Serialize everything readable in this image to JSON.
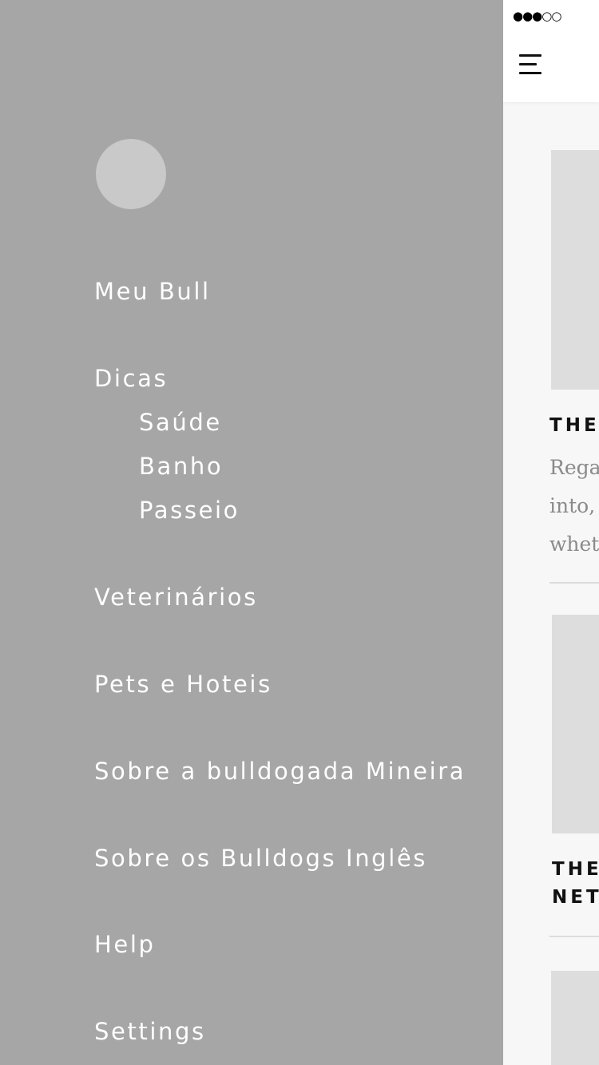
{
  "status_bar": {
    "signal": "●●●○○"
  },
  "drawer": {
    "menu": [
      {
        "label": "Meu Bull"
      },
      {
        "label": "Dicas"
      },
      {
        "label": "Saúde"
      },
      {
        "label": "Banho"
      },
      {
        "label": "Passeio"
      },
      {
        "label": "Veterinários"
      },
      {
        "label": "Pets e Hoteis"
      },
      {
        "label": "Sobre a bulldogada Mineira"
      },
      {
        "label": "Sobre os Bulldogs Inglês"
      },
      {
        "label": "Help"
      },
      {
        "label": "Settings"
      }
    ]
  },
  "main": {
    "cards": [
      {
        "title_lines": [
          "THE"
        ],
        "text_lines": [
          "Rega",
          "into,",
          "whet"
        ]
      },
      {
        "title_lines": [
          "THE",
          "NET"
        ]
      }
    ]
  },
  "colors": {
    "drawer_bg": "#a6a6a6",
    "avatar": "#c9c9c9",
    "content_bg": "#f7f7f7",
    "image_placeholder": "#dddddd"
  }
}
